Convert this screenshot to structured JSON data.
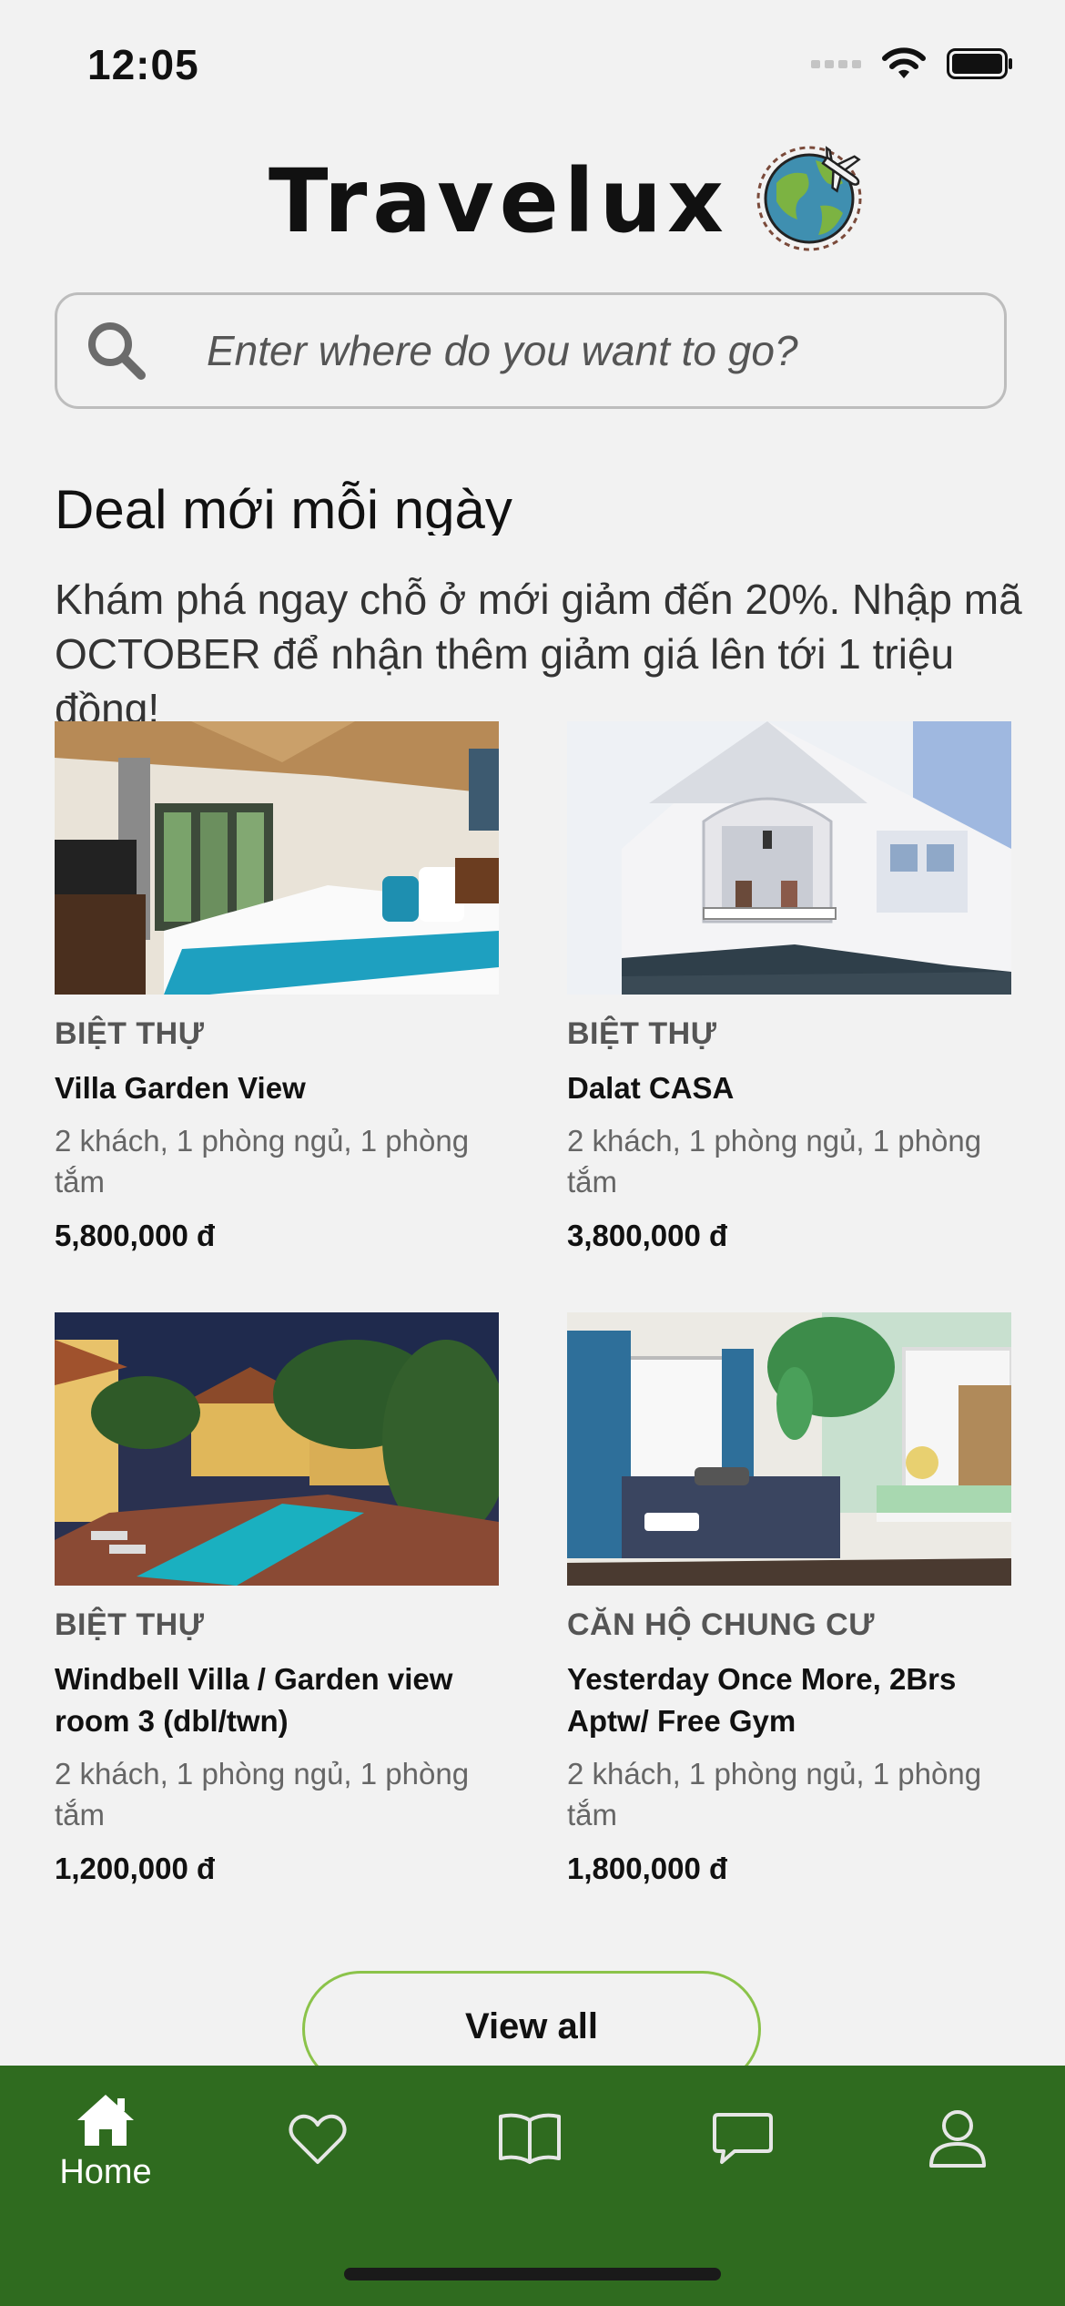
{
  "status_bar": {
    "time": "12:05"
  },
  "header": {
    "app_name": "Travelux"
  },
  "search": {
    "placeholder": "Enter where do you want to go?"
  },
  "deals": {
    "title": "Deal mới mỗi ngày",
    "description": "Khám phá ngay chỗ ở mới giảm đến 20%. Nhập mã OCTOBER để nhận thêm giảm giá lên tới 1 triệu đồng!"
  },
  "listings": [
    {
      "type": "BIỆT THỰ",
      "name": "Villa Garden View",
      "details": "2 khách, 1 phòng ngủ, 1 phòng tắm",
      "price": "5,800,000 đ"
    },
    {
      "type": "BIỆT THỰ",
      "name": "Dalat CASA",
      "details": "2 khách, 1 phòng ngủ, 1 phòng tắm",
      "price": "3,800,000 đ"
    },
    {
      "type": "BIỆT THỰ",
      "name": "Windbell Villa / Garden view room 3 (dbl/twn)",
      "details": "2 khách, 1 phòng ngủ, 1 phòng tắm",
      "price": "1,200,000 đ"
    },
    {
      "type": "CĂN HỘ CHUNG CƯ",
      "name": "Yesterday Once More, 2Brs Aptw/ Free Gym",
      "details": "2 khách, 1 phòng ngủ, 1 phòng tắm",
      "price": "1,800,000 đ"
    }
  ],
  "view_all_label": "View all",
  "nav": {
    "items": [
      {
        "label": "Home",
        "icon": "home-icon",
        "active": true
      },
      {
        "label": "",
        "icon": "heart-icon",
        "active": false
      },
      {
        "label": "",
        "icon": "book-icon",
        "active": false
      },
      {
        "label": "",
        "icon": "chat-icon",
        "active": false
      },
      {
        "label": "",
        "icon": "profile-icon",
        "active": false
      }
    ]
  },
  "colors": {
    "nav_background": "#2f6b1f",
    "view_all_border": "#8bc34a",
    "background": "#f2f2f2"
  }
}
